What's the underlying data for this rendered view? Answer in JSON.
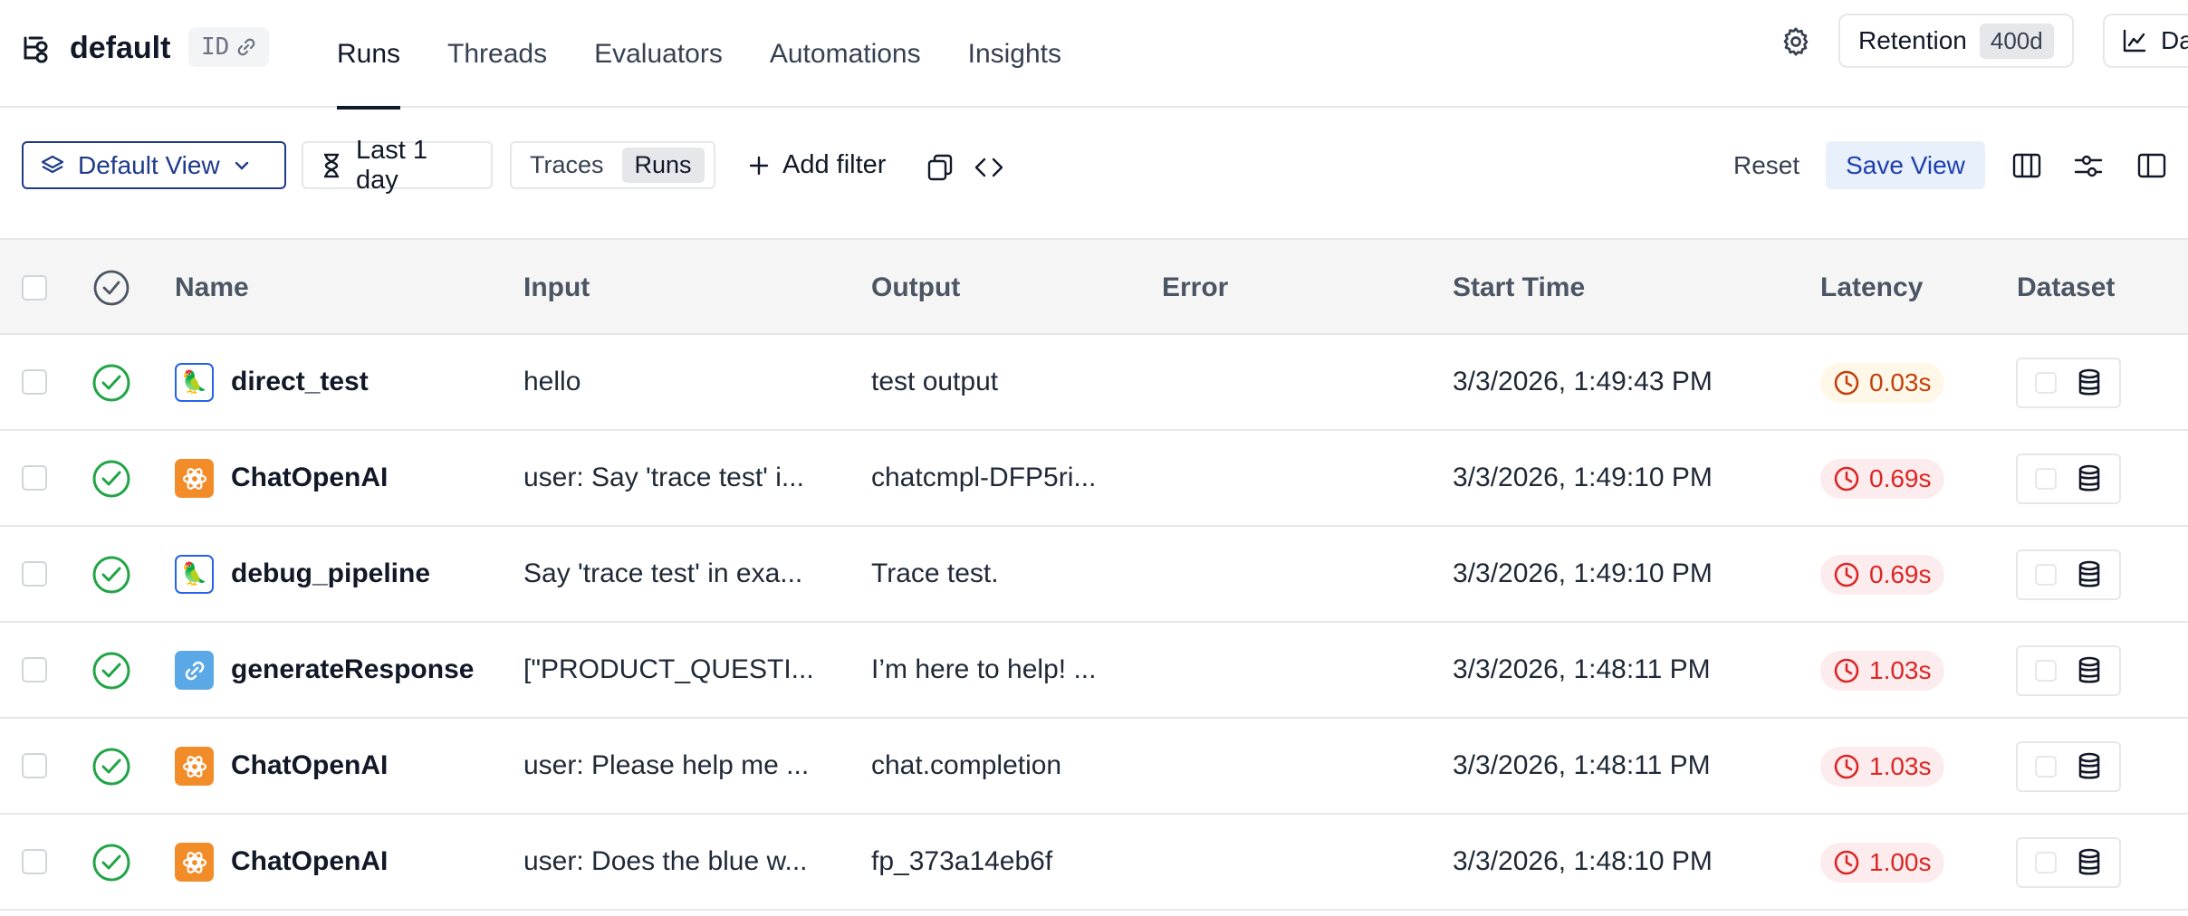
{
  "header": {
    "project_icon": "project-tree-icon",
    "project_name": "default",
    "id_label": "ID",
    "tabs": [
      {
        "label": "Runs",
        "active": true
      },
      {
        "label": "Threads",
        "active": false
      },
      {
        "label": "Evaluators",
        "active": false
      },
      {
        "label": "Automations",
        "active": false
      },
      {
        "label": "Insights",
        "active": false
      }
    ],
    "retention_label": "Retention",
    "retention_value": "400d",
    "dashboard_label": "Da"
  },
  "toolbar": {
    "view_label": "Default View",
    "time_label": "Last 1 day",
    "segment": [
      {
        "label": "Traces",
        "active": false
      },
      {
        "label": "Runs",
        "active": true
      }
    ],
    "add_filter_label": "Add filter",
    "reset_label": "Reset",
    "save_view_label": "Save View"
  },
  "table": {
    "columns": [
      "Name",
      "Input",
      "Output",
      "Error",
      "Start Time",
      "Latency",
      "Dataset"
    ],
    "rows": [
      {
        "icon": "parrot-icon",
        "name": "direct_test",
        "input": "hello",
        "output": "test output",
        "error": "",
        "start_time": "3/3/2026, 1:49:43 PM",
        "latency": "0.03s",
        "latency_level": "warn"
      },
      {
        "icon": "openai-icon",
        "name": "ChatOpenAI",
        "input": "user: Say 'trace test' i...",
        "output": "chatcmpl-DFP5ri...",
        "error": "",
        "start_time": "3/3/2026, 1:49:10 PM",
        "latency": "0.69s",
        "latency_level": "bad"
      },
      {
        "icon": "parrot-icon",
        "name": "debug_pipeline",
        "input": "Say 'trace test' in exa...",
        "output": "Trace test.",
        "error": "",
        "start_time": "3/3/2026, 1:49:10 PM",
        "latency": "0.69s",
        "latency_level": "bad"
      },
      {
        "icon": "chain-link-icon",
        "name": "generateResponse",
        "input": "[\"PRODUCT_QUESTI...",
        "output": "I’m here to help! ...",
        "error": "",
        "start_time": "3/3/2026, 1:48:11 PM",
        "latency": "1.03s",
        "latency_level": "bad"
      },
      {
        "icon": "openai-icon",
        "name": "ChatOpenAI",
        "input": "user: Please help me ...",
        "output": "chat.completion",
        "error": "",
        "start_time": "3/3/2026, 1:48:11 PM",
        "latency": "1.03s",
        "latency_level": "bad"
      },
      {
        "icon": "openai-icon",
        "name": "ChatOpenAI",
        "input": "user: Does the blue w...",
        "output": "fp_373a14eb6f",
        "error": "",
        "start_time": "3/3/2026, 1:48:10 PM",
        "latency": "1.00s",
        "latency_level": "bad"
      }
    ]
  },
  "colors": {
    "accent": "#1e3a8a",
    "success": "#22a447",
    "latency_warn": "#c2410c",
    "latency_bad": "#dc2626",
    "openai_tile": "#f28c28",
    "chain_tile": "#5aa9e6"
  }
}
